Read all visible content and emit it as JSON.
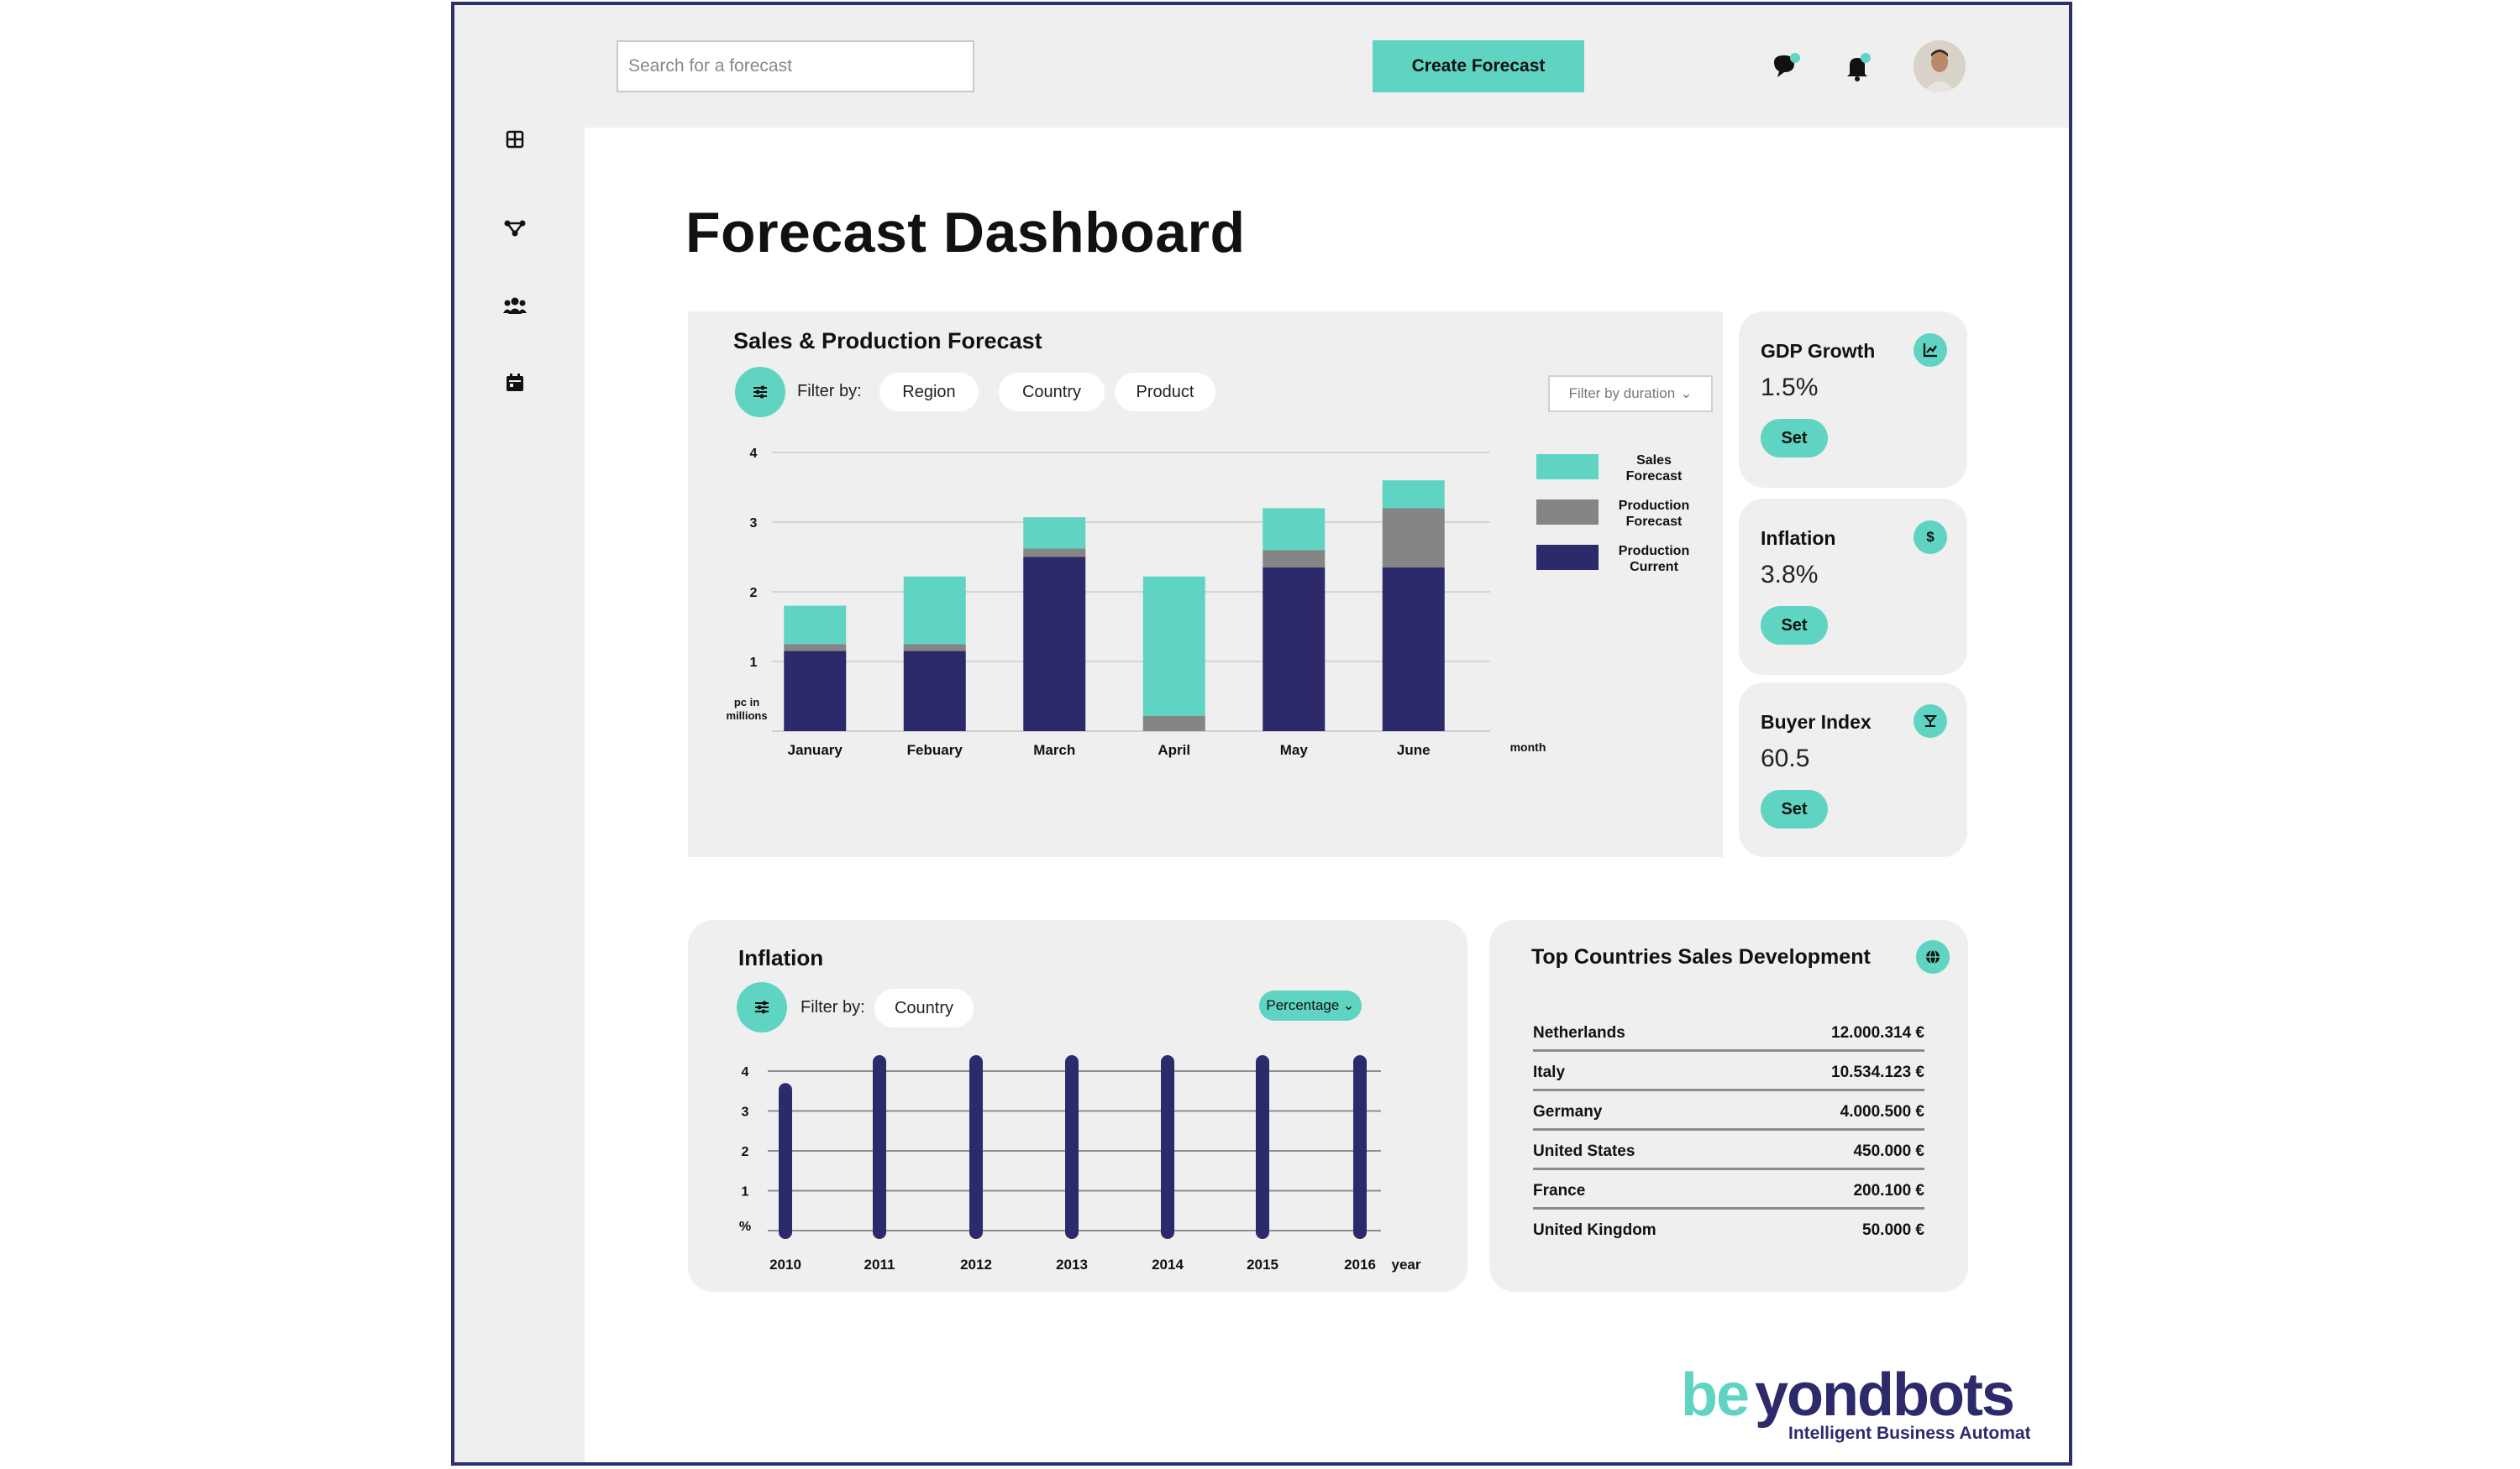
{
  "topbar": {
    "search_placeholder": "Search for a forecast",
    "create_button_label": "Create Forecast"
  },
  "sidebar": {
    "items": [
      {
        "icon": "grid-icon"
      },
      {
        "icon": "network-icon"
      },
      {
        "icon": "users-icon"
      },
      {
        "icon": "calendar-icon"
      }
    ]
  },
  "page": {
    "title": "Forecast Dashboard"
  },
  "sales_card": {
    "title": "Sales & Production Forecast",
    "filter_label": "Filter by:",
    "filters": [
      "Region",
      "Country",
      "Product"
    ],
    "duration_filter": "Filter by duration"
  },
  "metrics": [
    {
      "title": "GDP Growth",
      "value": "1.5%",
      "button": "Set",
      "icon": "chart-icon"
    },
    {
      "title": "Inflation",
      "value": "3.8%",
      "button": "Set",
      "icon": "dollar-icon"
    },
    {
      "title": "Buyer Index",
      "value": "60.5",
      "button": "Set",
      "icon": "buyer-icon"
    }
  ],
  "inflation_card": {
    "title": "Inflation",
    "filter_label": "Filter by:",
    "filter": "Country",
    "unit_button": "Percentage"
  },
  "countries_card": {
    "title": "Top Countries Sales Development",
    "rows": [
      {
        "country": "Netherlands",
        "value": "12.000.314 €"
      },
      {
        "country": "Italy",
        "value": "10.534.123 €"
      },
      {
        "country": "Germany",
        "value": "4.000.500 €"
      },
      {
        "country": "United States",
        "value": "450.000 €"
      },
      {
        "country": "France",
        "value": "200.100 €"
      },
      {
        "country": "United Kingdom",
        "value": "50.000 €"
      }
    ]
  },
  "logo": {
    "name": "beyondbots",
    "tagline": "Intelligent Business Automation"
  },
  "colors": {
    "teal": "#5fd4c2",
    "navy": "#2d2a6b",
    "grey": "#858585"
  },
  "chart_data": [
    {
      "type": "bar",
      "stacked": true,
      "categories": [
        "January",
        "Febuary",
        "March",
        "April",
        "May",
        "June"
      ],
      "series": [
        {
          "name": "Production Current",
          "values": [
            1.15,
            1.15,
            2.5,
            0,
            2.35,
            2.35
          ]
        },
        {
          "name": "Production Forecast",
          "values": [
            0.1,
            0.1,
            0.12,
            0.22,
            0.25,
            0.85
          ]
        },
        {
          "name": "Sales Forecast",
          "values": [
            0.55,
            0.97,
            0.45,
            2.0,
            0.6,
            0.4
          ]
        }
      ],
      "ylabel": "pc in millions",
      "xlabel": "month",
      "yticks": [
        1,
        2,
        3,
        4
      ],
      "ylim": [
        0,
        4
      ],
      "grid": true,
      "legend": "right"
    },
    {
      "type": "bar",
      "categories": [
        "2010",
        "2011",
        "2012",
        "2013",
        "2014",
        "2015",
        "2016"
      ],
      "values": [
        3.7,
        4.4,
        4.4,
        4.4,
        4.4,
        4.4,
        4.4
      ],
      "ylabel": "%",
      "xlabel": "year",
      "yticks": [
        1,
        2,
        3,
        4
      ],
      "ylim": [
        0,
        4.4
      ],
      "grid": true
    }
  ]
}
